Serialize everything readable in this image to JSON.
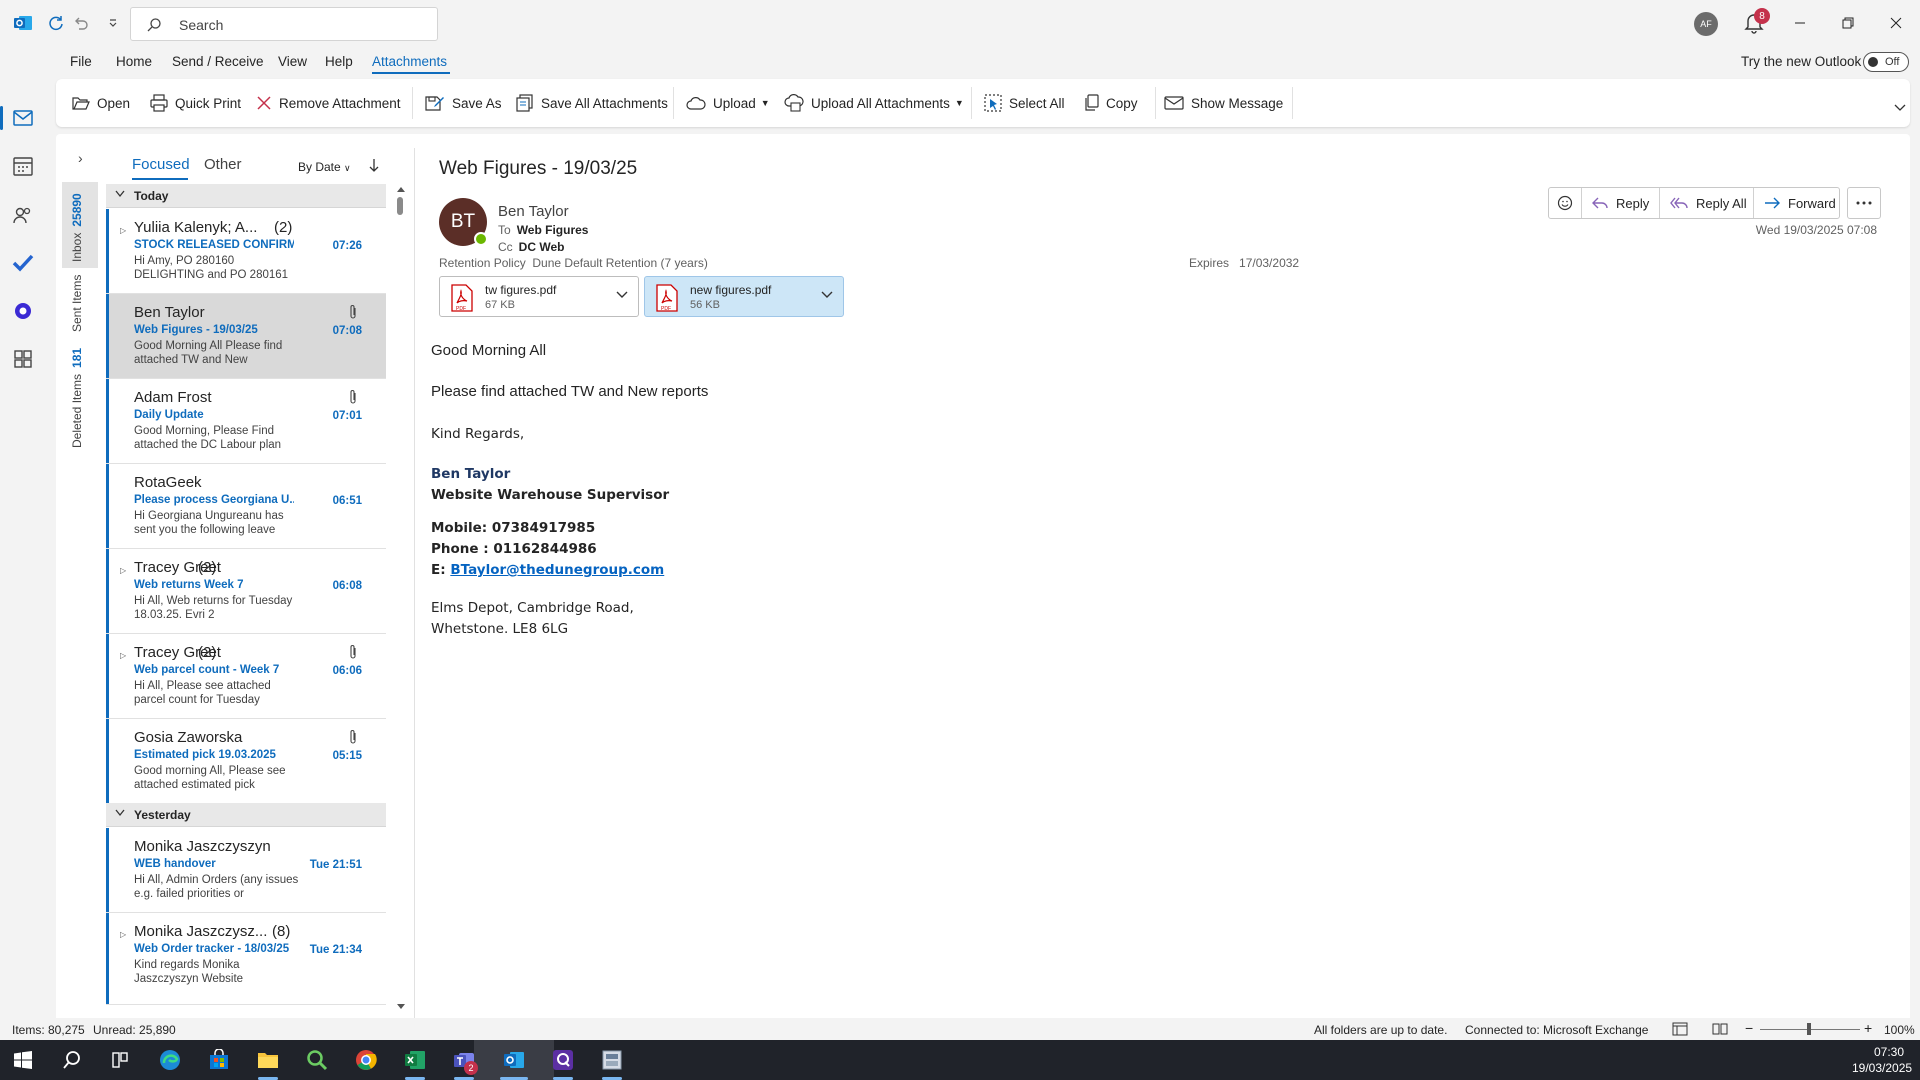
{
  "titlebar": {
    "search_placeholder": "Search",
    "avatar_initials": "AF",
    "notification_count": "8"
  },
  "menu": {
    "tabs": [
      "File",
      "Home",
      "Send / Receive",
      "View",
      "Help",
      "Attachments"
    ],
    "active": "Attachments",
    "try_new": "Try the new Outlook",
    "toggle": "Off"
  },
  "ribbon": {
    "open": "Open",
    "quick_print": "Quick Print",
    "remove_attachment": "Remove Attachment",
    "save_as": "Save As",
    "save_all": "Save All Attachments",
    "upload": "Upload",
    "upload_all": "Upload All Attachments",
    "select_all": "Select All",
    "copy": "Copy",
    "show_message": "Show Message"
  },
  "folders": {
    "inbox": "Inbox",
    "inbox_count": "25890",
    "sent": "Sent Items",
    "deleted": "Deleted Items",
    "deleted_count": "181"
  },
  "list": {
    "focused": "Focused",
    "other": "Other",
    "sort": "By Date",
    "group_today": "Today",
    "group_yesterday": "Yesterday",
    "items": [
      {
        "from": "Yuliia Kalenyk; A...",
        "count": "(2)",
        "subject": "STOCK RELEASED CONFIRM...",
        "time": "07:26",
        "preview": "Hi Amy,  PO 280160 DELIGHTING and PO 280161"
      },
      {
        "from": "Ben Taylor",
        "count": "",
        "subject": "Web Figures - 19/03/25",
        "time": "07:08",
        "preview": "Good Morning All  Please find attached TW and New"
      },
      {
        "from": "Adam Frost",
        "count": "",
        "subject": "Daily Update",
        "time": "07:01",
        "preview": "Good Morning,  Please Find attached the DC Labour plan"
      },
      {
        "from": "RotaGeek",
        "count": "",
        "subject": "Please process Georgiana U...",
        "time": "06:51",
        "preview": "Hi Georgiana Ungureanu has sent you the following leave"
      },
      {
        "from": "Tracey Greet",
        "count": "(2)",
        "subject": "Web returns Week 7",
        "time": "06:08",
        "preview": "Hi All,  Web returns for Tuesday 18.03.25.  Evri 2"
      },
      {
        "from": "Tracey Greet",
        "count": "(2)",
        "subject": "Web parcel count - Week 7",
        "time": "06:06",
        "preview": "Hi All,  Please see attached parcel count for Tuesday"
      },
      {
        "from": "Gosia Zaworska",
        "count": "",
        "subject": "Estimated pick 19.03.2025",
        "time": "05:15",
        "preview": "Good morning All,  Please see attached estimated pick"
      },
      {
        "from": "Monika Jaszczyszyn",
        "count": "",
        "subject": "WEB handover",
        "time": "Tue 21:51",
        "preview": "Hi All,  Admin  Orders (any issues e.g. failed priorities or"
      },
      {
        "from": "Monika Jaszczysz...",
        "count": "(8)",
        "subject": "Web Order tracker - 18/03/25",
        "time": "Tue 21:34",
        "preview": "Kind regards  Monika Jaszczyszyn  Website"
      }
    ]
  },
  "reading": {
    "subject": "Web Figures - 19/03/25",
    "initials": "BT",
    "sender": "Ben Taylor",
    "to_label": "To",
    "to": "Web Figures",
    "cc_label": "Cc",
    "cc": "DC Web",
    "retention_label": "Retention Policy",
    "retention": "Dune Default Retention (7 years)",
    "expires_label": "Expires",
    "expires": "17/03/2032",
    "attachments": [
      {
        "name": "tw figures.pdf",
        "size": "67 KB"
      },
      {
        "name": "new figures.pdf",
        "size": "56 KB"
      }
    ],
    "reply": "Reply",
    "reply_all": "Reply All",
    "forward": "Forward",
    "date": "Wed 19/03/2025 07:08",
    "body": {
      "greeting": "Good Morning All",
      "line1": "Please find attached TW and New reports",
      "regards": "Kind Regards,",
      "name": "Ben Taylor",
      "title": "Website Warehouse Supervisor",
      "mobile": "Mobile: 07384917985",
      "phone": "Phone : 01162844986",
      "email_label": "E: ",
      "email": "BTaylor@thedunegroup.com",
      "addr1": "Elms Depot, Cambridge Road,",
      "addr2": "Whetstone. LE8 6LG"
    }
  },
  "status": {
    "items": "Items: 80,275",
    "unread": "Unread: 25,890",
    "sync": "All folders are up to date.",
    "connected": "Connected to: Microsoft Exchange",
    "zoom": "100%"
  },
  "taskbar": {
    "time": "07:30",
    "date": "19/03/2025",
    "teams_badge": "2"
  },
  "colors": {
    "accent": "#0f6cbd",
    "avatar": "#5b2e27"
  }
}
